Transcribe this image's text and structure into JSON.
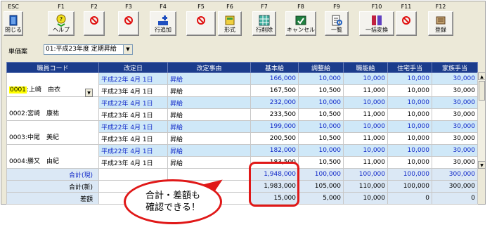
{
  "toolbar": [
    {
      "key": "ESC",
      "label": "閉じる",
      "icon": "close-door-icon"
    },
    {
      "key": "F1",
      "label": "ヘルプ",
      "icon": "help-icon"
    },
    {
      "key": "F2",
      "label": "",
      "icon": "disabled-icon"
    },
    {
      "key": "F3",
      "label": "",
      "icon": "disabled-icon"
    },
    {
      "key": "F4",
      "label": "行追加",
      "icon": "add-row-icon"
    },
    {
      "key": "F5",
      "label": "",
      "icon": "disabled-icon"
    },
    {
      "key": "F6",
      "label": "形式",
      "icon": "format-icon"
    },
    {
      "key": "F7",
      "label": "行削除",
      "icon": "delete-row-icon"
    },
    {
      "key": "F8",
      "label": "キャンセル",
      "icon": "cancel-icon"
    },
    {
      "key": "F9",
      "label": "一覧",
      "icon": "list-icon"
    },
    {
      "key": "F10",
      "label": "一括変換",
      "icon": "batch-convert-icon"
    },
    {
      "key": "F11",
      "label": "",
      "icon": "disabled-icon"
    },
    {
      "key": "F12",
      "label": "登録",
      "icon": "register-icon"
    }
  ],
  "selector": {
    "label": "単価案",
    "value": "01:平成23年度 定期昇給"
  },
  "columns": [
    "職員コード",
    "改定日",
    "改定事由",
    "基本給",
    "調整給",
    "職能給",
    "住宅手当",
    "家族手当"
  ],
  "employees": [
    {
      "code": "0001",
      "name": ":上崎　由衣",
      "rows": [
        [
          "平成22年 4月 1日",
          "昇給",
          "166,000",
          "10,000",
          "10,000",
          "10,000",
          "30,000"
        ],
        [
          "平成23年 4月 1日",
          "昇給",
          "167,500",
          "10,500",
          "11,000",
          "10,000",
          "30,000"
        ]
      ]
    },
    {
      "code": "0002",
      "name": ":宮崎　康祐",
      "rows": [
        [
          "平成22年 4月 1日",
          "昇給",
          "232,000",
          "10,000",
          "10,000",
          "10,000",
          "30,000"
        ],
        [
          "平成23年 4月 1日",
          "昇給",
          "233,500",
          "10,500",
          "11,000",
          "10,000",
          "30,000"
        ]
      ]
    },
    {
      "code": "0003",
      "name": ":中尾　美紀",
      "rows": [
        [
          "平成22年 4月 1日",
          "昇給",
          "199,000",
          "10,000",
          "10,000",
          "10,000",
          "30,000"
        ],
        [
          "平成23年 4月 1日",
          "昇給",
          "200,500",
          "10,500",
          "11,000",
          "10,000",
          "30,000"
        ]
      ]
    },
    {
      "code": "0004",
      "name": ":勝又　由紀",
      "rows": [
        [
          "平成22年 4月 1日",
          "昇給",
          "182,000",
          "10,000",
          "10,000",
          "10,000",
          "30,000"
        ],
        [
          "平成23年 4月 1日",
          "昇給",
          "183,500",
          "10,500",
          "11,000",
          "10,000",
          "30,000"
        ]
      ]
    }
  ],
  "totals": [
    {
      "label": "合計(現)",
      "values": [
        "1,948,000",
        "100,000",
        "100,000",
        "100,000",
        "300,000"
      ]
    },
    {
      "label": "合計(新)",
      "values": [
        "1,983,000",
        "105,000",
        "110,000",
        "100,000",
        "300,000"
      ]
    },
    {
      "label": "差額",
      "values": [
        "15,000",
        "5,000",
        "10,000",
        "0",
        "0"
      ]
    }
  ],
  "callout": {
    "line1": "合計・差額も",
    "line2": "確認できる！"
  }
}
